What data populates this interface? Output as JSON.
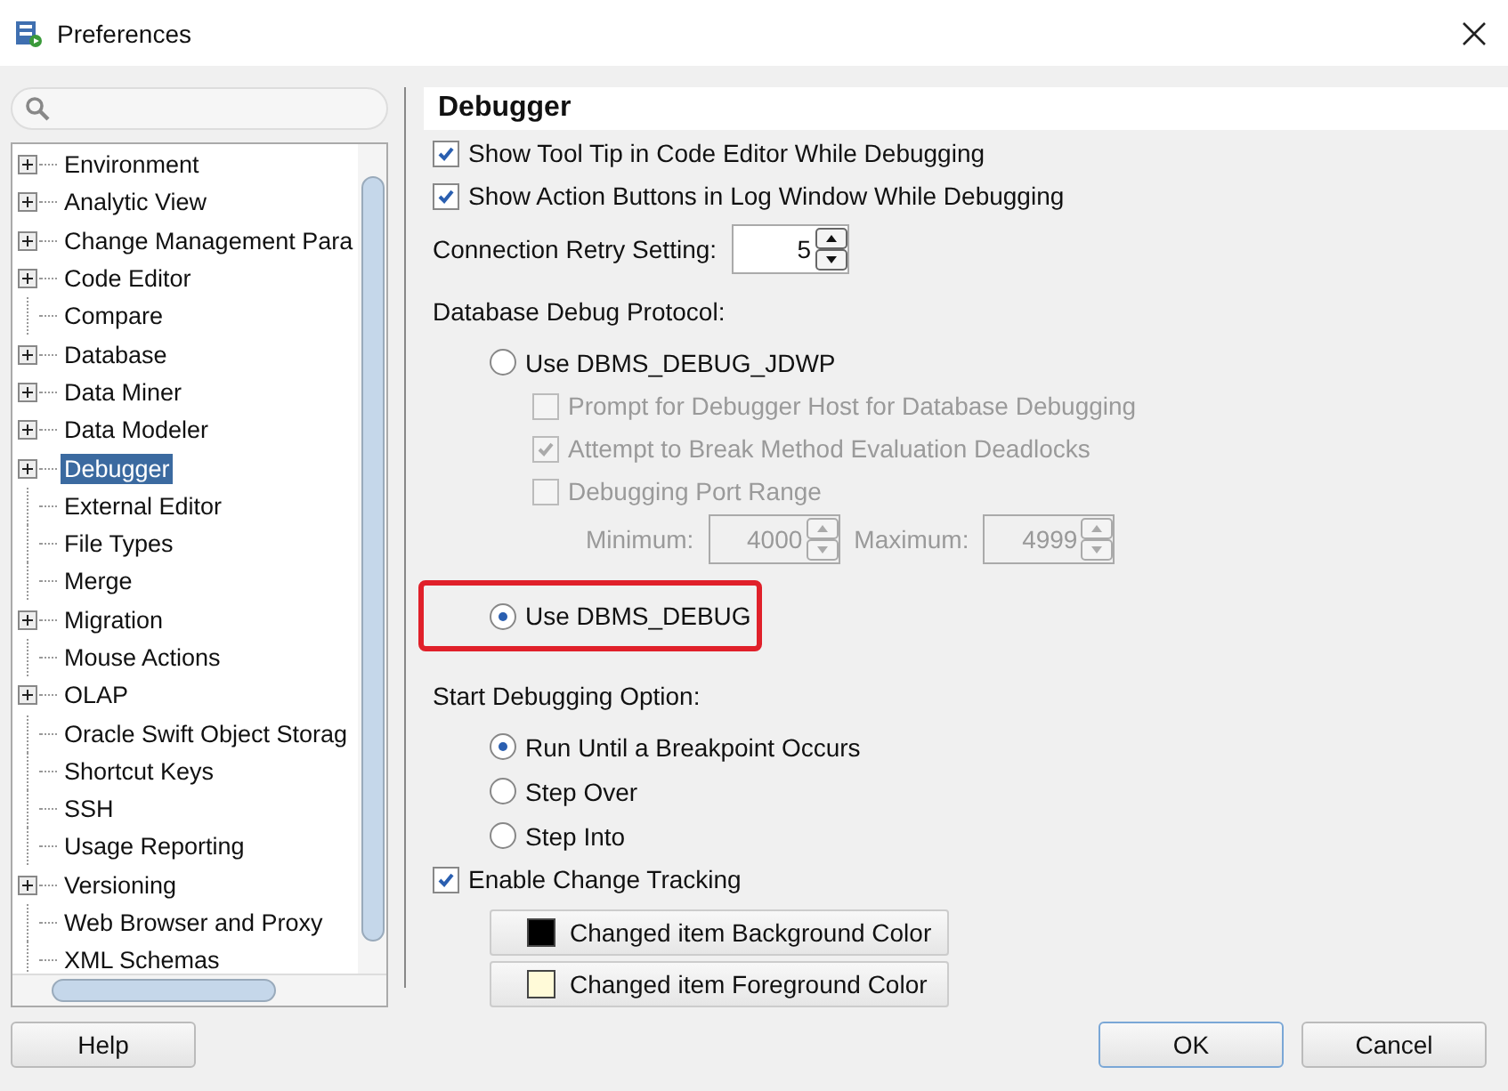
{
  "window": {
    "title": "Preferences"
  },
  "sidebar": {
    "tree": [
      {
        "label": "Environment",
        "expandable": true,
        "selected": false
      },
      {
        "label": "Analytic View",
        "expandable": true,
        "selected": false
      },
      {
        "label": "Change Management Para",
        "expandable": true,
        "selected": false
      },
      {
        "label": "Code Editor",
        "expandable": true,
        "selected": false
      },
      {
        "label": "Compare",
        "expandable": false,
        "selected": false
      },
      {
        "label": "Database",
        "expandable": true,
        "selected": false
      },
      {
        "label": "Data Miner",
        "expandable": true,
        "selected": false
      },
      {
        "label": "Data Modeler",
        "expandable": true,
        "selected": false
      },
      {
        "label": "Debugger",
        "expandable": true,
        "selected": true
      },
      {
        "label": "External Editor",
        "expandable": false,
        "selected": false
      },
      {
        "label": "File Types",
        "expandable": false,
        "selected": false
      },
      {
        "label": "Merge",
        "expandable": false,
        "selected": false
      },
      {
        "label": "Migration",
        "expandable": true,
        "selected": false
      },
      {
        "label": "Mouse Actions",
        "expandable": false,
        "selected": false
      },
      {
        "label": "OLAP",
        "expandable": true,
        "selected": false
      },
      {
        "label": "Oracle Swift Object Storag",
        "expandable": false,
        "selected": false
      },
      {
        "label": "Shortcut Keys",
        "expandable": false,
        "selected": false
      },
      {
        "label": "SSH",
        "expandable": false,
        "selected": false
      },
      {
        "label": "Usage Reporting",
        "expandable": false,
        "selected": false
      },
      {
        "label": "Versioning",
        "expandable": true,
        "selected": false
      },
      {
        "label": "Web Browser and Proxy",
        "expandable": false,
        "selected": false
      },
      {
        "label": "XML Schemas",
        "expandable": false,
        "selected": false
      }
    ]
  },
  "panel": {
    "title": "Debugger",
    "items": [
      {
        "kind": "checkbox",
        "label": "Show Tool Tip in Code Editor While Debugging",
        "checked": true,
        "disabled": false
      },
      {
        "kind": "checkbox",
        "label": "Show Action Buttons in Log Window While Debugging",
        "checked": true,
        "disabled": false
      },
      {
        "kind": "spinner",
        "label": "Connection Retry Setting:",
        "value": "5"
      },
      {
        "kind": "group",
        "label": "Database Debug Protocol:",
        "options": [
          {
            "label": "Use DBMS_DEBUG_JDWP",
            "selected": false,
            "highlighted": false,
            "children": [
              {
                "kind": "checkbox",
                "label": "Prompt for Debugger Host for Database Debugging",
                "checked": false,
                "disabled": true
              },
              {
                "kind": "checkbox",
                "label": "Attempt to Break Method Evaluation Deadlocks",
                "checked": true,
                "disabled": true
              },
              {
                "kind": "checkbox",
                "label": "Debugging Port Range",
                "checked": false,
                "disabled": true
              },
              {
                "kind": "range",
                "disabled": true,
                "fields": [
                  {
                    "label": "Minimum:",
                    "value": "4000"
                  },
                  {
                    "label": "Maximum:",
                    "value": "4999"
                  }
                ]
              }
            ]
          },
          {
            "label": "Use DBMS_DEBUG",
            "selected": true,
            "highlighted": true
          }
        ]
      },
      {
        "kind": "group",
        "label": "Start Debugging Option:",
        "options": [
          {
            "label": "Run Until a Breakpoint Occurs",
            "selected": true,
            "highlighted": false
          },
          {
            "label": "Step Over",
            "selected": false,
            "highlighted": false
          },
          {
            "label": "Step Into",
            "selected": false,
            "highlighted": false
          }
        ]
      },
      {
        "kind": "checkbox",
        "label": "Enable Change Tracking",
        "checked": true,
        "disabled": false,
        "children": [
          {
            "kind": "color_button",
            "label": "Changed item Background Color",
            "color": "#000000"
          },
          {
            "kind": "color_button",
            "label": "Changed item Foreground Color",
            "color": "#fffad8"
          }
        ]
      }
    ]
  },
  "buttons": {
    "left": [
      "Help"
    ],
    "right": [
      "OK",
      "Cancel"
    ]
  }
}
